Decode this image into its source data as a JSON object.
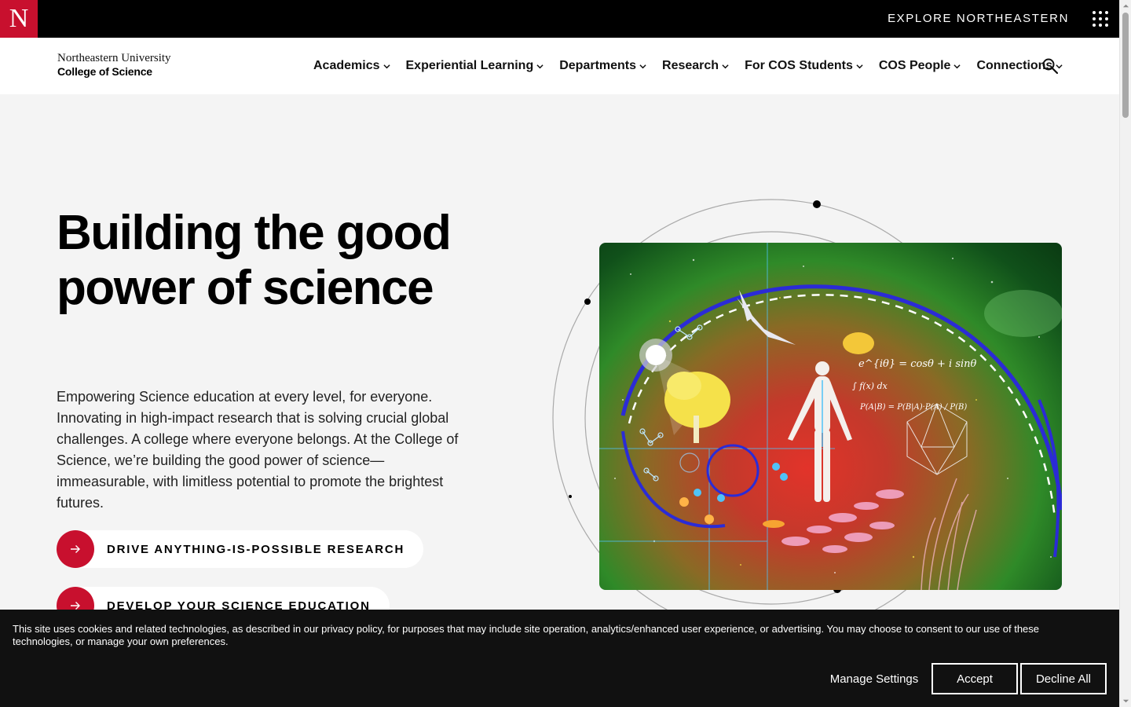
{
  "topbar": {
    "logo_letter": "N",
    "explore_label": "EXPLORE NORTHEASTERN"
  },
  "header": {
    "brand_line1": "Northeastern University",
    "brand_line2": "College of Science",
    "nav": [
      {
        "label": "Academics"
      },
      {
        "label": "Experiential Learning"
      },
      {
        "label": "Departments"
      },
      {
        "label": "Research"
      },
      {
        "label": "For COS Students"
      },
      {
        "label": "COS People"
      },
      {
        "label": "Connections"
      }
    ]
  },
  "hero": {
    "title": "Building the good power of science",
    "text": "Empowering Science education at every level, for everyone. Innovating in high-impact research that is solving crucial global challenges. A college where everyone belongs. At the College of Science, we’re building the good power of science—immeasurable, with limitless potential to promote the brightest futures.",
    "cta": [
      {
        "label": "DRIVE ANYTHING-IS-POSSIBLE RESEARCH"
      },
      {
        "label": "DEVELOP YOUR SCIENCE EDUCATION"
      }
    ],
    "art_equations": [
      "e^{iθ} = cosθ + i sinθ",
      "∫ f(x) dx",
      "P(A|B) = P(B|A)·P(A) / P(B)"
    ]
  },
  "cookie": {
    "text": "This site uses cookies and related technologies, as described in our privacy policy, for purposes that may include site operation, analytics/enhanced user experience, or advertising. You may choose to consent to our use of these technologies, or manage your own preferences.",
    "manage_label": "Manage Settings",
    "accept_label": "Accept",
    "decline_label": "Decline All"
  },
  "colors": {
    "brand_red": "#c8102e",
    "topbar_bg": "#000000",
    "page_bg": "#f4f4f4",
    "cookie_bg": "#111111"
  },
  "icons": [
    "northeastern-n-logo",
    "grid-menu-icon",
    "chevron-down-icon",
    "search-icon",
    "arrow-right-icon"
  ]
}
